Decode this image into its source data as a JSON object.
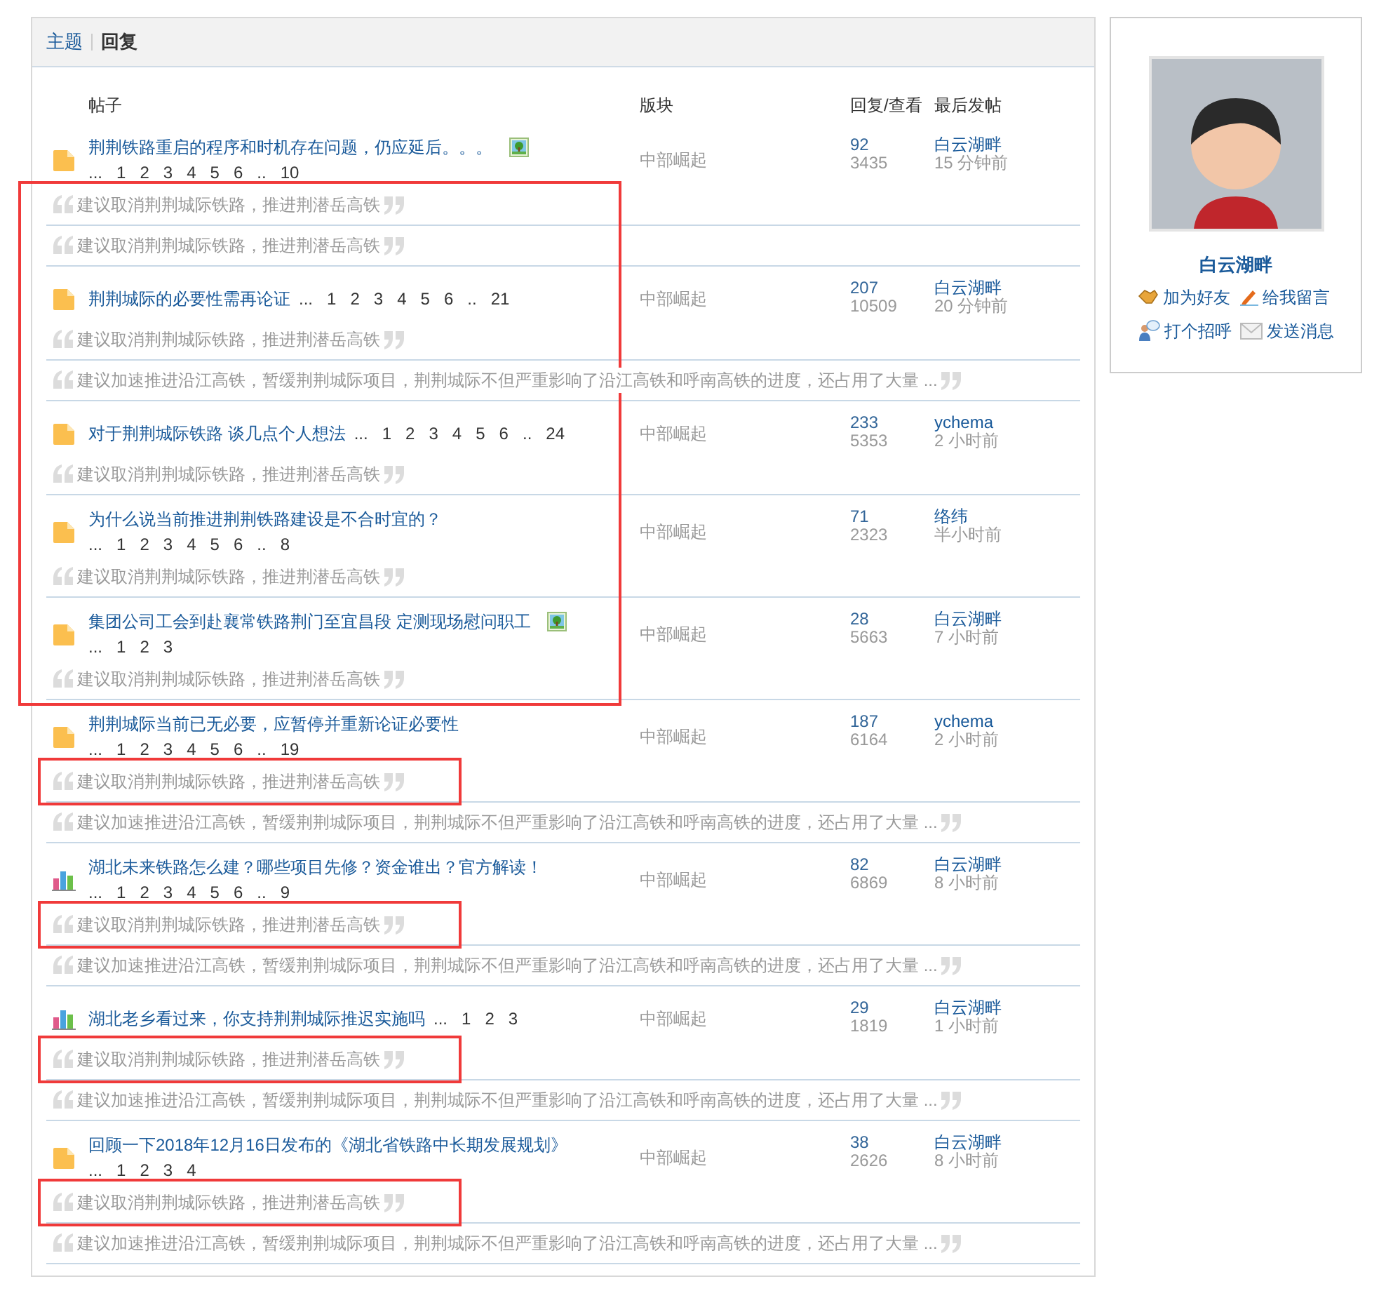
{
  "tabs": [
    {
      "label": "主题",
      "selected": false
    },
    {
      "label": "回复",
      "selected": true
    }
  ],
  "columns": [
    "帖子",
    "版块",
    "回复/查看",
    "最后发帖"
  ],
  "blocks": [
    {
      "highlighted": false,
      "rows": [
        {
          "kind": "folder",
          "title": "荆荆铁路重启的程序和时机存在问题，仍应延后。。。",
          "has_image": true,
          "pages_line": [
            "...",
            "1",
            "2",
            "3",
            "4",
            "5",
            "6",
            "..",
            "10"
          ],
          "forum": "中部崛起",
          "replies": "92",
          "views": "3435",
          "last_user": "白云湖畔",
          "last_time": "15 分钟前"
        }
      ]
    },
    {
      "highlighted": true,
      "rows": [
        {
          "kind": "quote",
          "text": "建议取消荆荆城际铁路，推进荆潜岳高铁"
        },
        {
          "kind": "quote",
          "text": "建议取消荆荆城际铁路，推进荆潜岳高铁"
        },
        {
          "kind": "folder",
          "title": "荆荆城际的必要性需再论证",
          "has_image": false,
          "pages": [
            "...",
            "1",
            "2",
            "3",
            "4",
            "5",
            "6",
            "..",
            "21"
          ],
          "forum": "中部崛起",
          "replies": "207",
          "views": "10509",
          "last_user": "白云湖畔",
          "last_time": "20 分钟前"
        },
        {
          "kind": "quote",
          "text": "建议取消荆荆城际铁路，推进荆潜岳高铁"
        },
        {
          "kind": "quote",
          "text": "建议加速推进沿江高铁，暂缓荆荆城际项目，荆荆城际不但严重影响了沿江高铁和呼南高铁的进度，还占用了大量 ..."
        },
        {
          "kind": "folder",
          "title": "对于荆荆城际铁路 谈几点个人想法",
          "has_image": false,
          "pages": [
            "...",
            "1",
            "2",
            "3",
            "4",
            "5",
            "6",
            "..",
            "24"
          ],
          "forum": "中部崛起",
          "replies": "233",
          "views": "5353",
          "last_user": "ychema",
          "last_time": "2 小时前"
        },
        {
          "kind": "quote",
          "text": "建议取消荆荆城际铁路，推进荆潜岳高铁"
        },
        {
          "kind": "folder",
          "title": "为什么说当前推进荆荆铁路建设是不合时宜的？",
          "has_image": false,
          "pages_line": [
            "...",
            "1",
            "2",
            "3",
            "4",
            "5",
            "6",
            "..",
            "8"
          ],
          "forum": "中部崛起",
          "replies": "71",
          "views": "2323",
          "last_user": "络纬",
          "last_time": "半小时前"
        },
        {
          "kind": "quote",
          "text": "建议取消荆荆城际铁路，推进荆潜岳高铁"
        },
        {
          "kind": "folder",
          "title": "集团公司工会到赴襄常铁路荆门至宜昌段 定测现场慰问职工",
          "has_image": true,
          "pages_line": [
            "...",
            "1",
            "2",
            "3"
          ],
          "forum": "中部崛起",
          "replies": "28",
          "views": "5663",
          "last_user": "白云湖畔",
          "last_time": "7 小时前"
        },
        {
          "kind": "quote",
          "text": "建议取消荆荆城际铁路，推进荆潜岳高铁"
        }
      ]
    },
    {
      "highlighted": false,
      "rows": [
        {
          "kind": "folder",
          "title": "荆荆城际当前已无必要，应暂停并重新论证必要性",
          "has_image": false,
          "pages_line": [
            "...",
            "1",
            "2",
            "3",
            "4",
            "5",
            "6",
            "..",
            "19"
          ],
          "forum": "中部崛起",
          "replies": "187",
          "views": "6164",
          "last_user": "ychema",
          "last_time": "2 小时前"
        }
      ]
    },
    {
      "highlighted": true,
      "rows": [
        {
          "kind": "quote",
          "text": "建议取消荆荆城际铁路，推进荆潜岳高铁"
        }
      ]
    },
    {
      "highlighted": false,
      "rows": [
        {
          "kind": "quote",
          "text": "建议加速推进沿江高铁，暂缓荆荆城际项目，荆荆城际不但严重影响了沿江高铁和呼南高铁的进度，还占用了大量 ..."
        },
        {
          "kind": "chart",
          "title": "湖北未来铁路怎么建？哪些项目先修？资金谁出？官方解读！",
          "has_image": false,
          "pages_line": [
            "...",
            "1",
            "2",
            "3",
            "4",
            "5",
            "6",
            "..",
            "9"
          ],
          "forum": "中部崛起",
          "replies": "82",
          "views": "6869",
          "last_user": "白云湖畔",
          "last_time": "8 小时前"
        }
      ]
    },
    {
      "highlighted": true,
      "rows": [
        {
          "kind": "quote",
          "text": "建议取消荆荆城际铁路，推进荆潜岳高铁"
        }
      ]
    },
    {
      "highlighted": false,
      "rows": [
        {
          "kind": "quote",
          "text": "建议加速推进沿江高铁，暂缓荆荆城际项目，荆荆城际不但严重影响了沿江高铁和呼南高铁的进度，还占用了大量 ..."
        },
        {
          "kind": "chart",
          "title": "湖北老乡看过来，你支持荆荆城际推迟实施吗",
          "has_image": false,
          "pages": [
            "...",
            "1",
            "2",
            "3"
          ],
          "forum": "中部崛起",
          "replies": "29",
          "views": "1819",
          "last_user": "白云湖畔",
          "last_time": "1 小时前"
        }
      ]
    },
    {
      "highlighted": true,
      "rows": [
        {
          "kind": "quote",
          "text": "建议取消荆荆城际铁路，推进荆潜岳高铁"
        }
      ]
    },
    {
      "highlighted": false,
      "rows": [
        {
          "kind": "quote",
          "text": "建议加速推进沿江高铁，暂缓荆荆城际项目，荆荆城际不但严重影响了沿江高铁和呼南高铁的进度，还占用了大量 ..."
        },
        {
          "kind": "folder",
          "title": "回顾一下2018年12月16日发布的《湖北省铁路中长期发展规划》",
          "has_image": false,
          "pages_line": [
            "...",
            "1",
            "2",
            "3",
            "4"
          ],
          "forum": "中部崛起",
          "replies": "38",
          "views": "2626",
          "last_user": "白云湖畔",
          "last_time": "8 小时前"
        }
      ]
    },
    {
      "highlighted": true,
      "rows": [
        {
          "kind": "quote",
          "text": "建议取消荆荆城际铁路，推进荆潜岳高铁"
        }
      ]
    },
    {
      "highlighted": false,
      "rows": [
        {
          "kind": "quote",
          "text": "建议加速推进沿江高铁，暂缓荆荆城际项目，荆荆城际不但严重影响了沿江高铁和呼南高铁的进度，还占用了大量 ..."
        }
      ]
    }
  ],
  "profile": {
    "name": "白云湖畔",
    "actions": [
      {
        "kind": "friend",
        "label": "加为好友"
      },
      {
        "kind": "message",
        "label": "给我留言"
      },
      {
        "kind": "greet",
        "label": "打个招呼"
      },
      {
        "kind": "mail",
        "label": "发送消息"
      }
    ]
  }
}
